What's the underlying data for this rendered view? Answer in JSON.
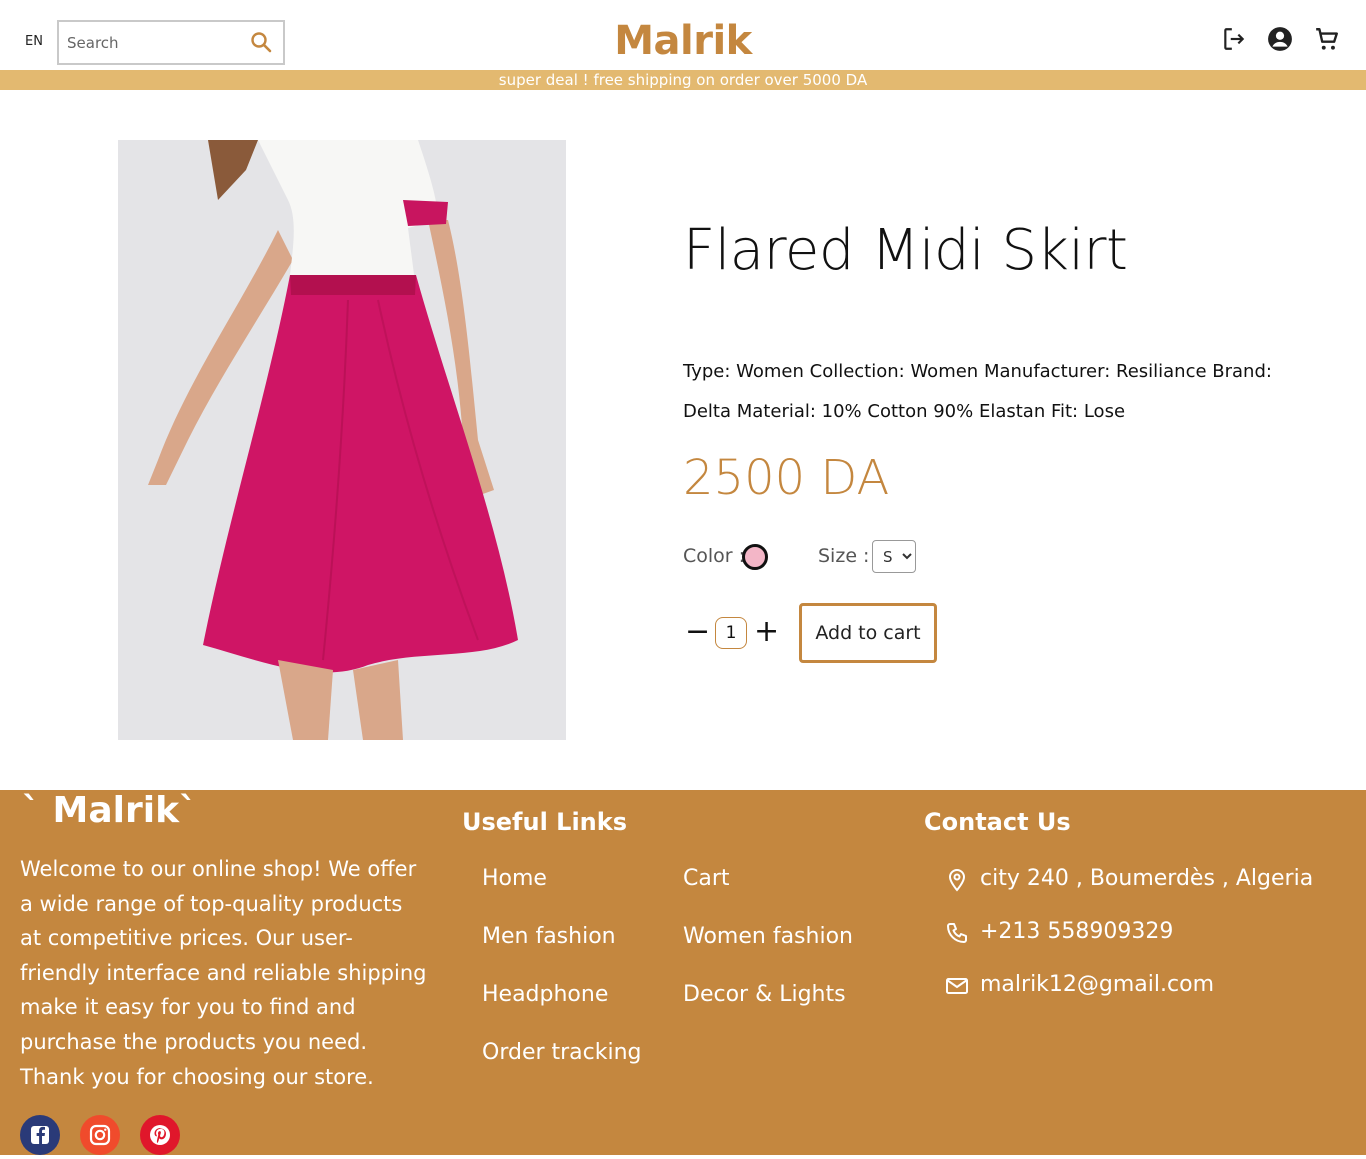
{
  "header": {
    "lang": "EN",
    "search_placeholder": "Search",
    "logo": "Malrik",
    "banner": "super deal ! free shipping on order over 5000 DA"
  },
  "product": {
    "title": "Flared Midi Skirt",
    "description": "Type: Women Collection: Women Manufacturer: Resiliance Brand: Delta Material: 10% Cotton 90% Elastan Fit: Lose",
    "price": "2500 DA",
    "color_label": "Color :",
    "color_value": "#f3b6c7",
    "size_label": "Size :",
    "size_options": [
      "S"
    ],
    "size_selected": "S",
    "quantity": "1",
    "minus": "−",
    "plus": "+",
    "add_to_cart": "Add to cart"
  },
  "footer": {
    "logo": "` Malrik`",
    "about": "Welcome to our online shop! We offer a wide range of top-quality products at competitive prices. Our user-friendly interface and reliable shipping make it easy for you to find and purchase the products you need. Thank you for choosing our store.",
    "useful_links_title": "Useful Links",
    "links_col1": [
      "Home",
      "Men fashion",
      "Headphone",
      "Order tracking"
    ],
    "links_col2": [
      "Cart",
      "Women fashion",
      "Decor & Lights"
    ],
    "contact_title": "Contact Us",
    "address": "city 240 , Boumerdès , Algeria",
    "phone": "+213 558909329",
    "email": "malrik12@gmail.com"
  },
  "colors": {
    "accent": "#c4873f",
    "banner": "#e3b970",
    "skirt": "#c8155f"
  }
}
